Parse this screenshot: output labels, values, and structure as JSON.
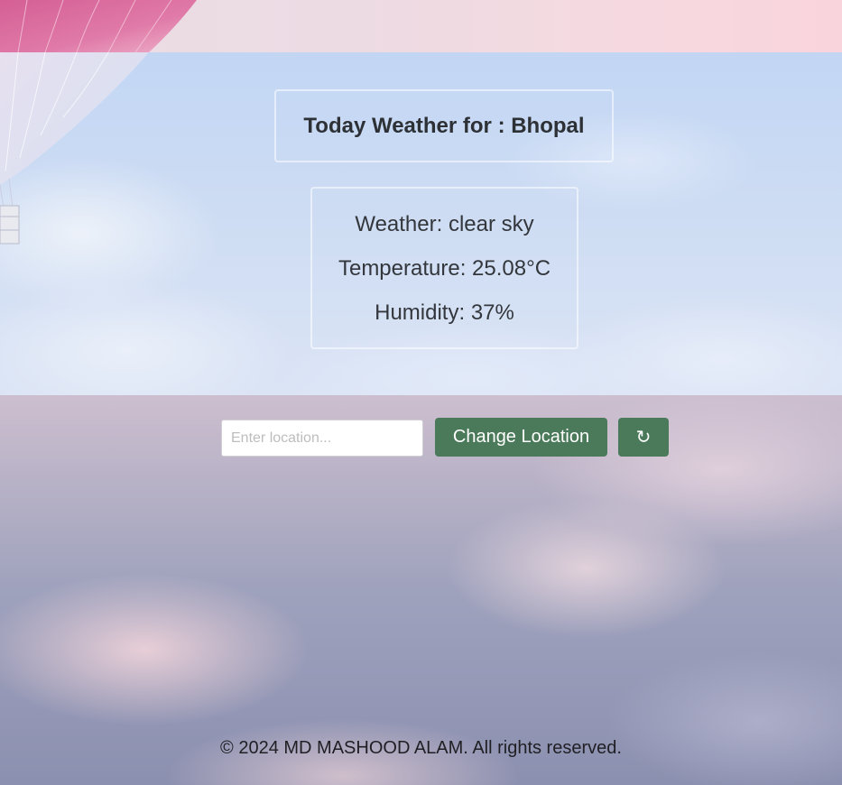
{
  "header": {
    "title": "Today Weather for : Bhopal"
  },
  "weather": {
    "description": "Weather: clear sky",
    "temperature": "Temperature: 25.08°C",
    "humidity": "Humidity: 37%"
  },
  "controls": {
    "location_placeholder": "Enter location...",
    "location_value": "",
    "change_location_label": "Change Location",
    "refresh_label": "↻"
  },
  "footer": {
    "text": "© 2024 MD MASHOOD ALAM. All rights reserved."
  },
  "colors": {
    "button": "#4a7a59",
    "text": "#2d3136"
  },
  "icons": {
    "refresh": "refresh-icon"
  }
}
